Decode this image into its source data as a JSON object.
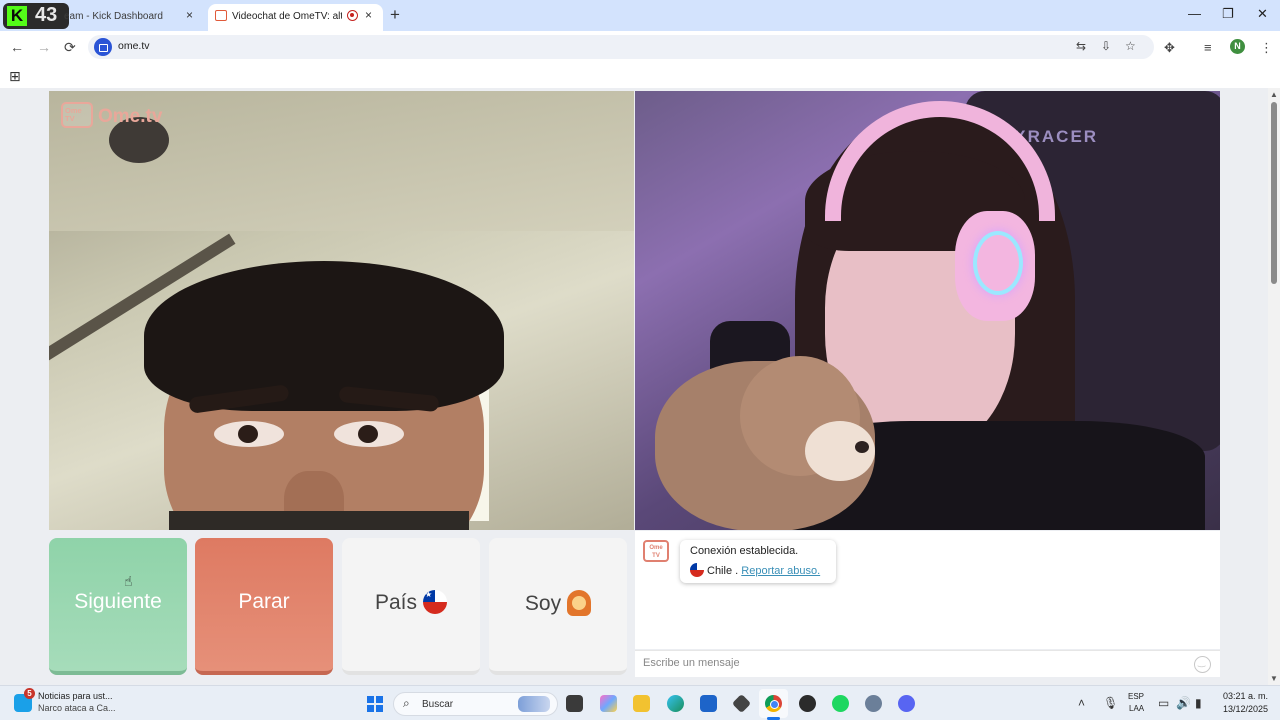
{
  "stream_overlay": {
    "letter": "K",
    "count": "43"
  },
  "browser": {
    "tabs": [
      {
        "title": "eam - Kick Dashboard",
        "close": "×"
      },
      {
        "title": "Videochat de OmeTV: altern",
        "close": "×"
      }
    ],
    "new_tab": "+",
    "window_controls": {
      "minimize": "—",
      "restore": "❐",
      "close": "✕"
    },
    "nav": {
      "back": "←",
      "forward": "→",
      "reload": "⟳"
    },
    "url": "ome.tv",
    "profile_initial": "N",
    "apps_icon": "⊞"
  },
  "page": {
    "logo": {
      "box_text": "Ome TV",
      "word": "Ome.tv",
      "color": "#e9a79a"
    },
    "partner_background_text": "DXRACER",
    "buttons": {
      "next": "Siguiente",
      "stop": "Parar",
      "country": "País",
      "gender": "Soy"
    },
    "chat": {
      "logo_text": "Ome TV",
      "status": "Conexión establecida.",
      "country": "Chile",
      "separator": ".",
      "report": "Reportar abuso.",
      "placeholder": "Escribe un mensaje"
    },
    "colors": {
      "next": "#8fd3a9",
      "stop": "#de7a62",
      "link": "#3a8fb7"
    }
  },
  "taskbar": {
    "news_badge": "5",
    "news_line1": "Noticias para ust...",
    "news_line2": "Narco ataca a Ca...",
    "search": "Buscar",
    "lang_line1": "ESP",
    "lang_line2": "LAA",
    "time": "03:21 a. m.",
    "date": "13/12/2025"
  }
}
